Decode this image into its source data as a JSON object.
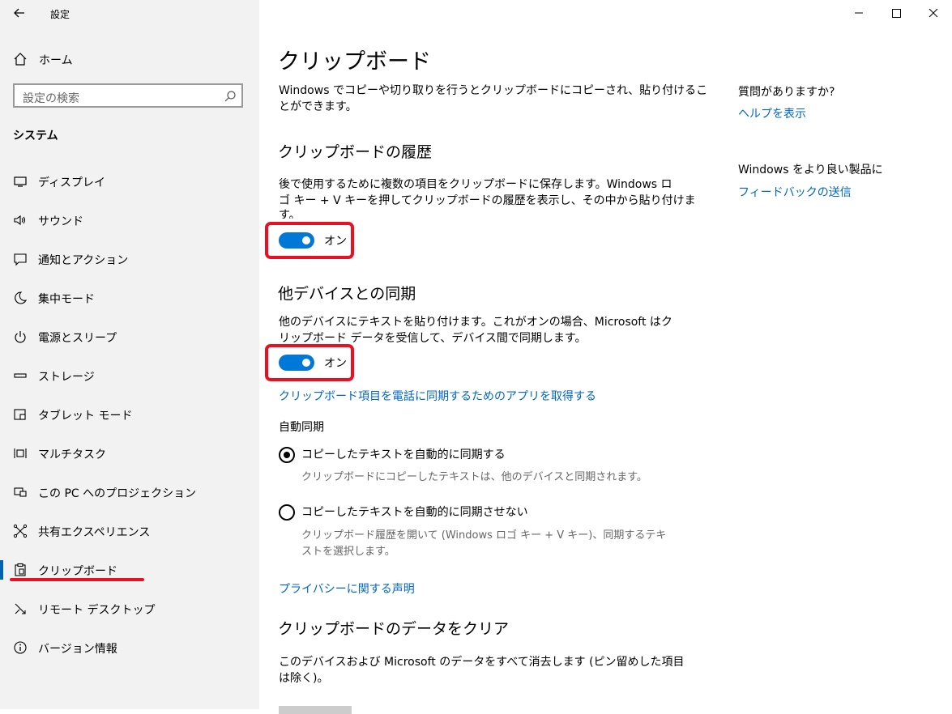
{
  "app": {
    "title": "設定"
  },
  "sidebar": {
    "home": "ホーム",
    "search_placeholder": "設定の検索",
    "section": "システム",
    "items": [
      {
        "label": "ディスプレイ",
        "icon": "display-icon"
      },
      {
        "label": "サウンド",
        "icon": "speaker-icon"
      },
      {
        "label": "通知とアクション",
        "icon": "notification-icon"
      },
      {
        "label": "集中モード",
        "icon": "moon-icon"
      },
      {
        "label": "電源とスリープ",
        "icon": "power-icon"
      },
      {
        "label": "ストレージ",
        "icon": "storage-icon"
      },
      {
        "label": "タブレット モード",
        "icon": "tablet-icon"
      },
      {
        "label": "マルチタスク",
        "icon": "multitask-icon"
      },
      {
        "label": "この PC へのプロジェクション",
        "icon": "projection-icon"
      },
      {
        "label": "共有エクスペリエンス",
        "icon": "share-icon"
      },
      {
        "label": "クリップボード",
        "icon": "clipboard-icon",
        "selected": true
      },
      {
        "label": "リモート デスクトップ",
        "icon": "remote-desktop-icon"
      },
      {
        "label": "バージョン情報",
        "icon": "info-icon"
      }
    ]
  },
  "main": {
    "title": "クリップボード",
    "intro_line1": "Windows でコピーや切り取りを行うとクリップボードにコピーされ、貼り付けるこ",
    "intro_line2": "とができます。",
    "history": {
      "heading": "クリップボードの履歴",
      "desc_line1": "後で使用するために複数の項目をクリップボードに保存します。Windows ロ",
      "desc_line2": "ゴ キー + V キーを押してクリップボードの履歴を表示し、その中から貼り付けま",
      "desc_line3": "す。",
      "toggle_label": "オン"
    },
    "sync": {
      "heading": "他デバイスとの同期",
      "desc_line1": "他のデバイスにテキストを貼り付けます。これがオンの場合、Microsoft はク",
      "desc_line2": "リップボード データを受信して、デバイス間で同期します。",
      "toggle_label": "オン",
      "get_app_link": "クリップボード項目を電話に同期するためのアプリを取得する",
      "auto_sync_label": "自動同期",
      "option1": "コピーしたテキストを自動的に同期する",
      "option1_desc": "クリップボードにコピーしたテキストは、他のデバイスと同期されます。",
      "option2": "コピーしたテキストを自動的に同期させない",
      "option2_desc_line1": "クリップボード履歴を開いて (Windows ロゴ キー + V キー)、同期するテキ",
      "option2_desc_line2": "ストを選択します。"
    },
    "privacy_link": "プライバシーに関する声明",
    "clear": {
      "heading": "クリップボードのデータをクリア",
      "desc_line1": "このデバイスおよび Microsoft のデータをすべて消去します (ピン留めした項目",
      "desc_line2": "は除く)。"
    }
  },
  "right": {
    "question": "質問がありますか?",
    "help_link": "ヘルプを表示",
    "feedback_text": "Windows をより良い製品に",
    "feedback_link": "フィードバックの送信"
  },
  "colors": {
    "accent": "#0078d7",
    "link": "#0067c0",
    "highlight": "#e81123"
  }
}
